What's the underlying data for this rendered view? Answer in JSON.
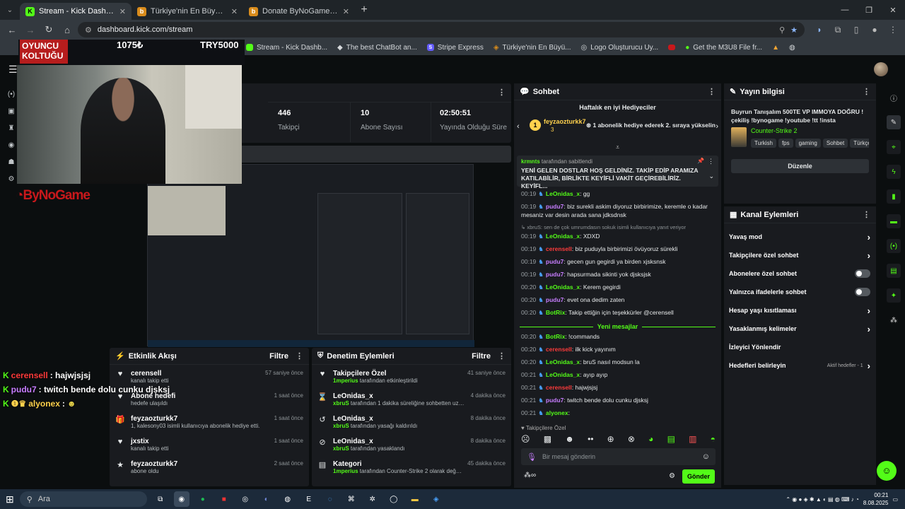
{
  "browser": {
    "tabs": [
      {
        "title": "Stream - Kick Dashboard",
        "icon": "kick-icon",
        "color": "#53fc18"
      },
      {
        "title": "Türkiye'nin En Büyük Oyuncu D",
        "icon": "bynogame-icon",
        "color": "#d98c1c"
      },
      {
        "title": "Donate ByNoGame - Gelen/Gi",
        "icon": "bynogame-icon",
        "color": "#d98c1c"
      }
    ],
    "url": "dashboard.kick.com/stream",
    "bookmarks": [
      "Stream - Kick Dashb...",
      "The best ChatBot an...",
      "Stripe Express",
      "Türkiye'nin En Büyü...",
      "Logo Oluşturucu Uy...",
      "Get the M3U8 File fr..."
    ]
  },
  "overlay": {
    "logo_line1": "OYUNCU",
    "logo_line2": "KOLTUĞU",
    "value1": "1075₺",
    "value2": "TRY5000",
    "brand": "ByNoGame",
    "chat": [
      {
        "user": "cerensell",
        "text": ": hajwjsjsj",
        "cls": "u3"
      },
      {
        "user": "pudu7",
        "text": ": twitch bende dolu cunku djsksj",
        "cls": "u2"
      },
      {
        "user": "alyonex",
        "text": ":",
        "cls": "u4"
      }
    ]
  },
  "stats": [
    {
      "value": "446",
      "label": "Takipçi"
    },
    {
      "value": "10",
      "label": "Abone Sayısı"
    },
    {
      "value": "02:50:51",
      "label": "Yayında Olduğu Süre"
    }
  ],
  "activity": {
    "title": "Etkinlik Akışı",
    "filter": "Filtre",
    "items": [
      {
        "icon": "heart-icon",
        "name": "cerensell",
        "sub": "kanalı takip etti",
        "time": "57 saniye önce"
      },
      {
        "icon": "heart-icon",
        "name": "Abone hedefi",
        "sub": "hedefe ulaşıldı",
        "time": "1 saat önce"
      },
      {
        "icon": "gift-icon",
        "name": "feyzaozturkk7",
        "sub": "1, kalesony03 isimli kullanıcıya abonelik hediye etti.",
        "time": "1 saat önce"
      },
      {
        "icon": "heart-icon",
        "name": "jxstix",
        "sub": "kanalı takip etti",
        "time": "1 saat önce"
      },
      {
        "icon": "star-icon",
        "name": "feyzaozturkk7",
        "sub": "abone oldu",
        "time": "2 saat önce"
      }
    ]
  },
  "moderation": {
    "title": "Denetim Eylemleri",
    "filter": "Filtre",
    "items": [
      {
        "icon": "heart-icon",
        "name": "Takipçilere Özel",
        "actor": "1mperius",
        "sub": " tarafından etkinleştirildi",
        "time": "41 saniye önce"
      },
      {
        "icon": "hourglass-icon",
        "name": "LeOnidas_x",
        "actor": "xbruS",
        "sub": " tarafından 1 dakika süreliğine sohbetten uzaklaştırıldı",
        "time": "4 dakika önce"
      },
      {
        "icon": "undo-icon",
        "name": "LeOnidas_x",
        "actor": "xbruS",
        "sub": " tarafından yasağı kaldırıldı",
        "time": "8 dakika önce"
      },
      {
        "icon": "ban-icon",
        "name": "LeOnidas_x",
        "actor": "xbruS",
        "sub": " tarafından yasaklandı",
        "time": "8 dakika önce"
      },
      {
        "icon": "category-icon",
        "name": "Kategori",
        "actor": "1mperius",
        "sub": " tarafından Counter-Strike 2 olarak değiştirildi",
        "time": "45 dakika önce"
      }
    ]
  },
  "chat": {
    "title": "Sohbet",
    "gifters_title": "Haftalık en iyi Hediyeciler",
    "gifter": "feyzaozturkk7",
    "gifter_count": "3",
    "gifter_note": "1 abonelik hediye ederek 2. sıraya yükselin",
    "pinned_by": "krmnts",
    "pinned_suffix": "tarafından sabitlendi",
    "pinned_text": "YENİ GELEN DOSTLAR HOŞ GELDİNİZ. TAKİP EDİP ARAMIZA KATILABİLİR, BİRLİKTE KEYİFLİ VAKİT GEÇİREBİLİRİZ. KEYİFL...",
    "messages_before": [
      {
        "t": "00:19",
        "user": "LeOnidas_x",
        "cls": "u1",
        "text": ": gg"
      },
      {
        "t": "00:19",
        "user": "pudu7",
        "cls": "u2",
        "text": ": biz surekli askim diyoruz birbirimize, keremle o kadar mesaniz var desin arada sana jdksdnsk"
      },
      {
        "t": "",
        "user": "",
        "cls": "",
        "text": "↳ xbruS: sen de çok umrumdasın sokuk isimli kullanıcıya yanıt veriyor"
      },
      {
        "t": "00:19",
        "user": "LeOnidas_x",
        "cls": "u1",
        "text": ": XDXD"
      },
      {
        "t": "00:19",
        "user": "cerensell",
        "cls": "u3",
        "text": ": biz puduyla birbirimizi övüyoruz sürekli"
      },
      {
        "t": "00:19",
        "user": "pudu7",
        "cls": "u2",
        "text": ": gecen gun gegirdi ya birden xjsksnsk"
      },
      {
        "t": "00:19",
        "user": "pudu7",
        "cls": "u2",
        "text": ": hapsurmada sikinti yok djsksjsk"
      },
      {
        "t": "00:20",
        "user": "LeOnidas_x",
        "cls": "u1",
        "text": ": Kerem gegirdi"
      },
      {
        "t": "00:20",
        "user": "pudu7",
        "cls": "u2",
        "text": ": evet ona dedim zaten"
      },
      {
        "t": "00:20",
        "user": "BotRix",
        "cls": "u1",
        "text": ": Takip ettiğin için teşekkürler @cerensell"
      }
    ],
    "new_messages": "Yeni mesajlar",
    "messages_after": [
      {
        "t": "00:20",
        "user": "BotRix",
        "cls": "u1",
        "text": ": !commands"
      },
      {
        "t": "00:20",
        "user": "cerensell",
        "cls": "u3",
        "text": ": ilk kick yayınım"
      },
      {
        "t": "00:20",
        "user": "LeOnidas_x",
        "cls": "u1",
        "text": ": bruS nasıl modsun la"
      },
      {
        "t": "00:21",
        "user": "LeOnidas_x",
        "cls": "u1",
        "text": ": ayıp ayıp"
      },
      {
        "t": "00:21",
        "user": "cerensell",
        "cls": "u3",
        "text": ": hajwjsjsj"
      },
      {
        "t": "00:21",
        "user": "pudu7",
        "cls": "u2",
        "text": ": twitch bende dolu cunku djsksj"
      },
      {
        "t": "00:21",
        "user": "alyonex",
        "cls": "u1",
        "text": ":"
      }
    ],
    "followers_only": "Takipçilere Özel",
    "placeholder": "Bir mesaj gönderin",
    "send": "Gönder"
  },
  "stream_info": {
    "title": "Yayın bilgisi",
    "stream_title": "Buyrun Tanışalım 500TE VP IMMOYA DOĞRU ! çekiliş !bynogame !youtube !tt !insta",
    "category": "Counter-Strike 2",
    "tags": [
      "Turkish",
      "fps",
      "gaming",
      "Sohbet",
      "Türkçe"
    ],
    "edit": "Düzenle"
  },
  "channel_actions": {
    "title": "Kanal Eylemleri",
    "items": [
      {
        "label": "Yavaş mod",
        "ctrl": "chevron"
      },
      {
        "label": "Takipçilere özel sohbet",
        "ctrl": "chevron"
      },
      {
        "label": "Abonelere özel sohbet",
        "ctrl": "toggle"
      },
      {
        "label": "Yalnızca ifadelerle sohbet",
        "ctrl": "toggle"
      },
      {
        "label": "Hesap yaşı kısıtlaması",
        "ctrl": "chevron"
      },
      {
        "label": "Yasaklanmış kelimeler",
        "ctrl": "chevron"
      },
      {
        "label": "İzleyici Yönlendir",
        "ctrl": "none"
      },
      {
        "label": "Hedefleri belirleyin",
        "ctrl": "chevron",
        "note": "Aktif hedefler - 1"
      }
    ]
  },
  "taskbar": {
    "search": "Ara",
    "time": "00:21",
    "date": "8.08.2025"
  },
  "colors": {
    "accent": "#53fc18",
    "panel": "#191b1f",
    "bg": "#0b0e0f"
  }
}
